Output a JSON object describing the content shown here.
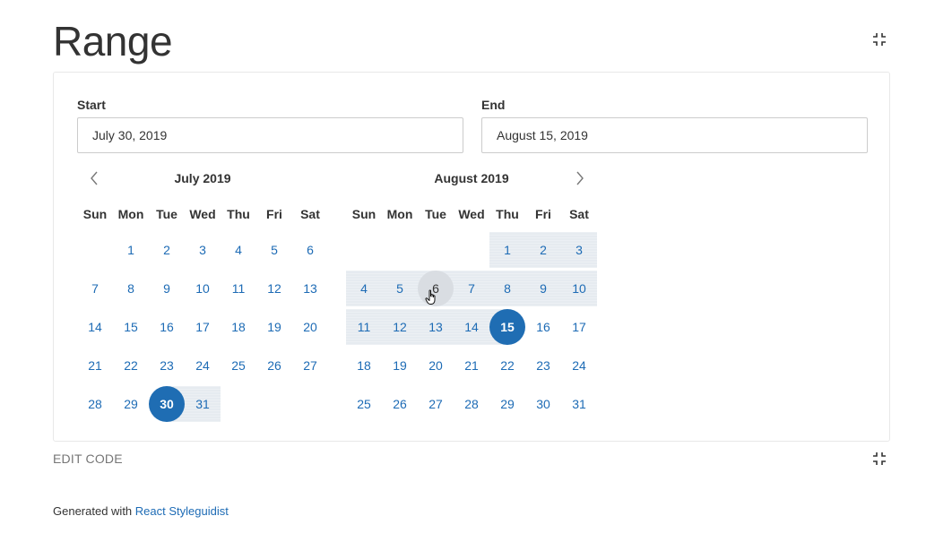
{
  "page": {
    "title": "Range",
    "edit_code_label": "EDIT CODE",
    "footer_prefix": "Generated with ",
    "footer_link": "React Styleguidist"
  },
  "icons": {
    "isolate_top": "collapse-icon",
    "isolate_bottom": "collapse-icon",
    "prev": "chevron-left-icon",
    "next": "chevron-right-icon",
    "cursor": "hand-pointer-icon"
  },
  "colors": {
    "accent": "#1f6db3",
    "day_text": "#1d6bb5",
    "range_bg": "#e6ebf0",
    "hover_bg": "#d9dde2"
  },
  "start": {
    "label": "Start",
    "value": "July 30, 2019"
  },
  "end": {
    "label": "End",
    "value": "August 15, 2019"
  },
  "weekdays": [
    "Sun",
    "Mon",
    "Tue",
    "Wed",
    "Thu",
    "Fri",
    "Sat"
  ],
  "months": [
    {
      "title": "July 2019",
      "first_weekday": 1,
      "days": [
        "1",
        "2",
        "3",
        "4",
        "5",
        "6",
        "7",
        "8",
        "9",
        "10",
        "11",
        "12",
        "13",
        "14",
        "15",
        "16",
        "17",
        "18",
        "19",
        "20",
        "21",
        "22",
        "23",
        "24",
        "25",
        "26",
        "27",
        "28",
        "29",
        "30",
        "31"
      ]
    },
    {
      "title": "August 2019",
      "first_weekday": 4,
      "days": [
        "1",
        "2",
        "3",
        "4",
        "5",
        "6",
        "7",
        "8",
        "9",
        "10",
        "11",
        "12",
        "13",
        "14",
        "15",
        "16",
        "17",
        "18",
        "19",
        "20",
        "21",
        "22",
        "23",
        "24",
        "25",
        "26",
        "27",
        "28",
        "29",
        "30",
        "31"
      ]
    }
  ],
  "range": {
    "start_day": "30",
    "end_day": "15",
    "hover_day": "6"
  }
}
